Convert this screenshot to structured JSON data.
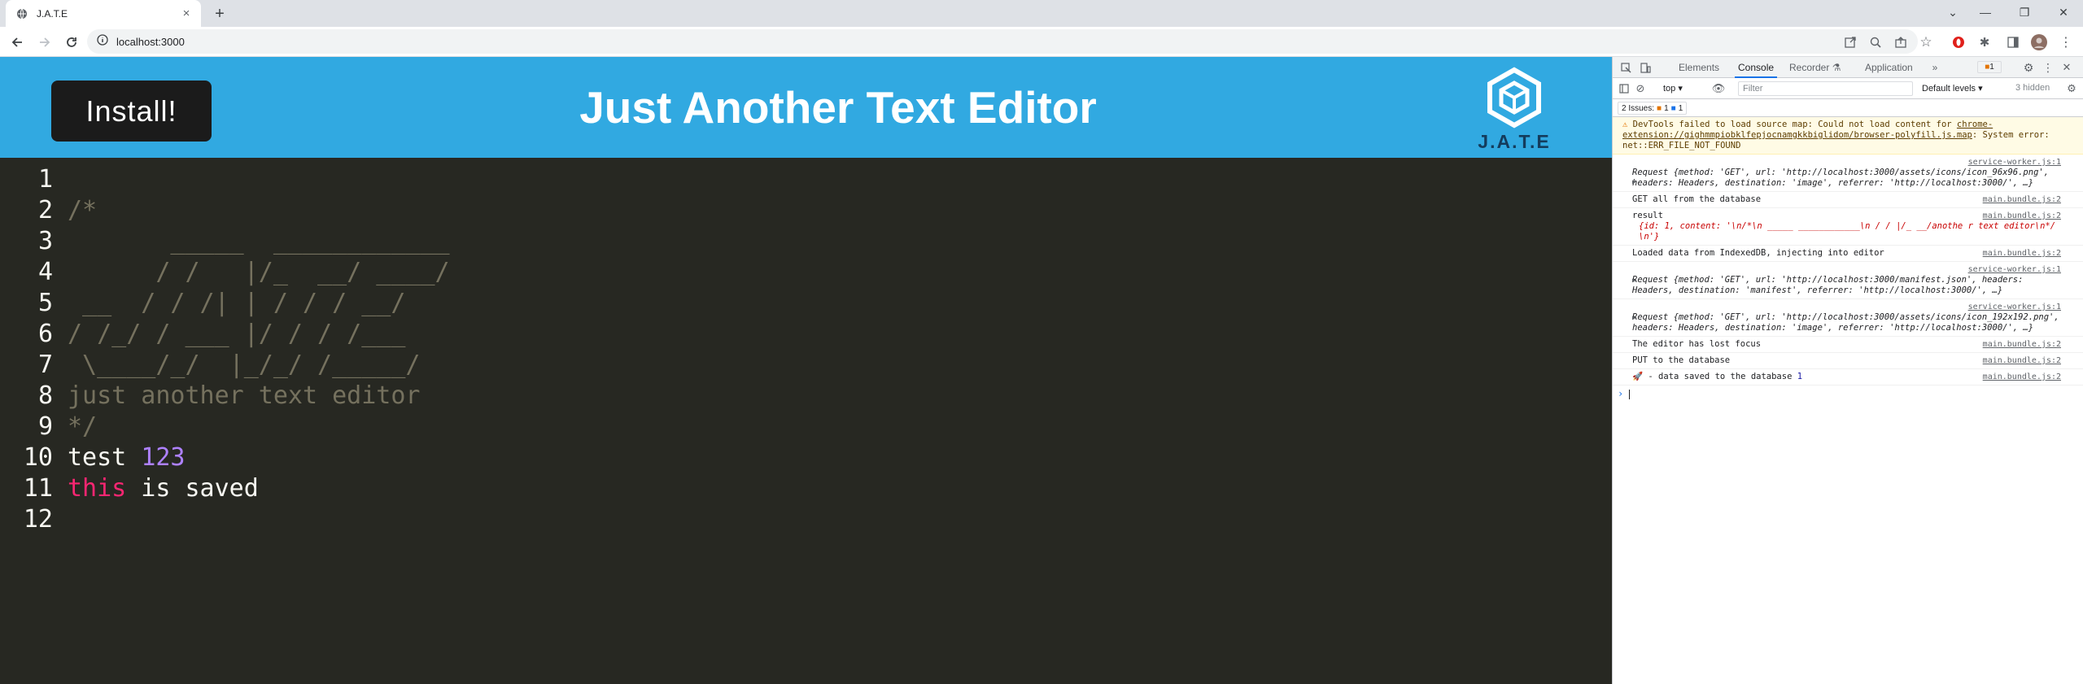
{
  "browser": {
    "tab_title": "J.A.T.E",
    "url": "localhost:3000"
  },
  "app": {
    "install_label": "Install!",
    "title": "Just Another Text Editor",
    "logo_text": "J.A.T.E",
    "accent_color": "#31a9e1"
  },
  "editor": {
    "lines": [
      {
        "num": "1"
      },
      {
        "num": "2",
        "text": "/*"
      },
      {
        "num": "3",
        "text": "       _____  ____________"
      },
      {
        "num": "4",
        "text": "      / /   |/_  __/ ____/"
      },
      {
        "num": "5",
        "text": " __  / / /| | / / / __/"
      },
      {
        "num": "6",
        "text": "/ /_/ / ___ |/ / / /___"
      },
      {
        "num": "7",
        "text": " \\____/_/  |_/_/ /_____/"
      },
      {
        "num": "8",
        "text": "just another text editor"
      },
      {
        "num": "9",
        "text": "*/"
      },
      {
        "num": "10",
        "word1": "test ",
        "number": "123"
      },
      {
        "num": "11",
        "kw": "this",
        "rest": " is saved"
      },
      {
        "num": "12"
      }
    ]
  },
  "devtools": {
    "tabs": [
      "Elements",
      "Console",
      "Recorder",
      "Application"
    ],
    "active_tab": "Console",
    "issue_badge": "1",
    "context": "top",
    "filter_placeholder": "Filter",
    "levels": "Default levels",
    "hidden": "3 hidden",
    "issues_label": "2 Issues:",
    "issues_warn": "1",
    "issues_info": "1",
    "messages": {
      "warn_text": "DevTools failed to load source map: Could not load content for ",
      "warn_link": "chrome-extension://gighmmpiobklfepjocnamgkkbiglidom/browser-polyfill.js.map",
      "warn_tail": ": System error: net::ERR_FILE_NOT_FOUND",
      "m1_src": "service-worker.js:1",
      "m1_text": "Request {method: 'GET', url: 'http://localhost:3000/assets/icons/icon_96x96.png', headers: Headers, destination: 'image', referrer: 'http://localhost:3000/', …}",
      "m2_text": "GET all from the database",
      "m2_src": "main.bundle.js:2",
      "m3_text": "result",
      "m3_src": "main.bundle.js:2",
      "m3_obj": "{id: 1, content: '\\n/*\\n       _____  ____________\\n      / /   |/_  __/anothe r text editor\\n*/                             \\n'}",
      "m4_text": "Loaded data from IndexedDB, injecting into editor",
      "m4_src": "main.bundle.js:2",
      "m5_src": "service-worker.js:1",
      "m5_text": "Request {method: 'GET', url: 'http://localhost:3000/manifest.json', headers: Headers, destination: 'manifest', referrer: 'http://localhost:3000/', …}",
      "m6_src": "service-worker.js:1",
      "m6_text": "Request {method: 'GET', url: 'http://localhost:3000/assets/icons/icon_192x192.png', headers: Headers, destination: 'image', referrer: 'http://localhost:3000/', …}",
      "m7_text": "The editor has lost focus",
      "m7_src": "main.bundle.js:2",
      "m8_text": "PUT to the database",
      "m8_src": "main.bundle.js:2",
      "m9_text": "🚀 - data saved to the database",
      "m9_num": "1",
      "m9_src": "main.bundle.js:2"
    }
  }
}
